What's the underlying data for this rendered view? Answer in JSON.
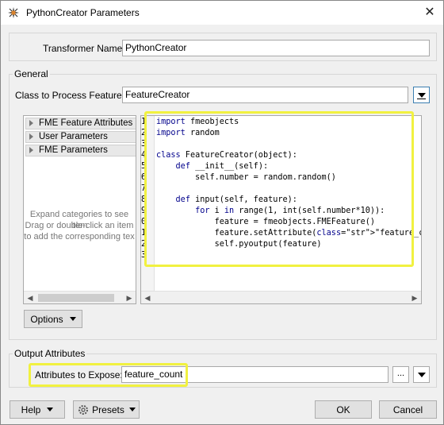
{
  "window": {
    "title": "PythonCreator Parameters",
    "close_glyph": "✕"
  },
  "transformer": {
    "label": "Transformer Name:",
    "value": "PythonCreator"
  },
  "general": {
    "title": "General",
    "class_label": "Class to Process Features:",
    "class_value": "FeatureCreator"
  },
  "categories": {
    "items": [
      {
        "label": "FME Feature Attributes"
      },
      {
        "label": "User Parameters"
      },
      {
        "label": "FME Parameters"
      }
    ],
    "hint_lines": [
      "Expand categories to see item",
      "Drag or double-click an item",
      "to add the corresponding tex"
    ]
  },
  "code": {
    "lines": [
      {
        "num": "1",
        "text": "import fmeobjects"
      },
      {
        "num": "2",
        "text": "import random"
      },
      {
        "num": "3",
        "text": ""
      },
      {
        "num": "4",
        "text": "class FeatureCreator(object):"
      },
      {
        "num": "5",
        "text": "    def __init__(self):"
      },
      {
        "num": "6",
        "text": "        self.number = random.random()"
      },
      {
        "num": "7",
        "text": ""
      },
      {
        "num": "8",
        "text": "    def input(self, feature):"
      },
      {
        "num": "9",
        "text": "        for i in range(1, int(self.number*10)):"
      },
      {
        "num": "0",
        "text": "            feature = fmeobjects.FMEFeature()"
      },
      {
        "num": "1",
        "text": "            feature.setAttribute(\"feature_count\", i)"
      },
      {
        "num": "2",
        "text": "            self.pyoutput(feature)"
      },
      {
        "num": "3",
        "text": ""
      }
    ]
  },
  "options_button": {
    "label": "Options"
  },
  "output": {
    "title": "Output Attributes",
    "expose_label": "Attributes to Expose:",
    "expose_value": "feature_count",
    "ellipsis": "..."
  },
  "footer": {
    "help": "Help",
    "presets": "Presets",
    "ok": "OK",
    "cancel": "Cancel"
  },
  "colors": {
    "highlight": "#f1f140",
    "accent": "#3c7fb1"
  }
}
